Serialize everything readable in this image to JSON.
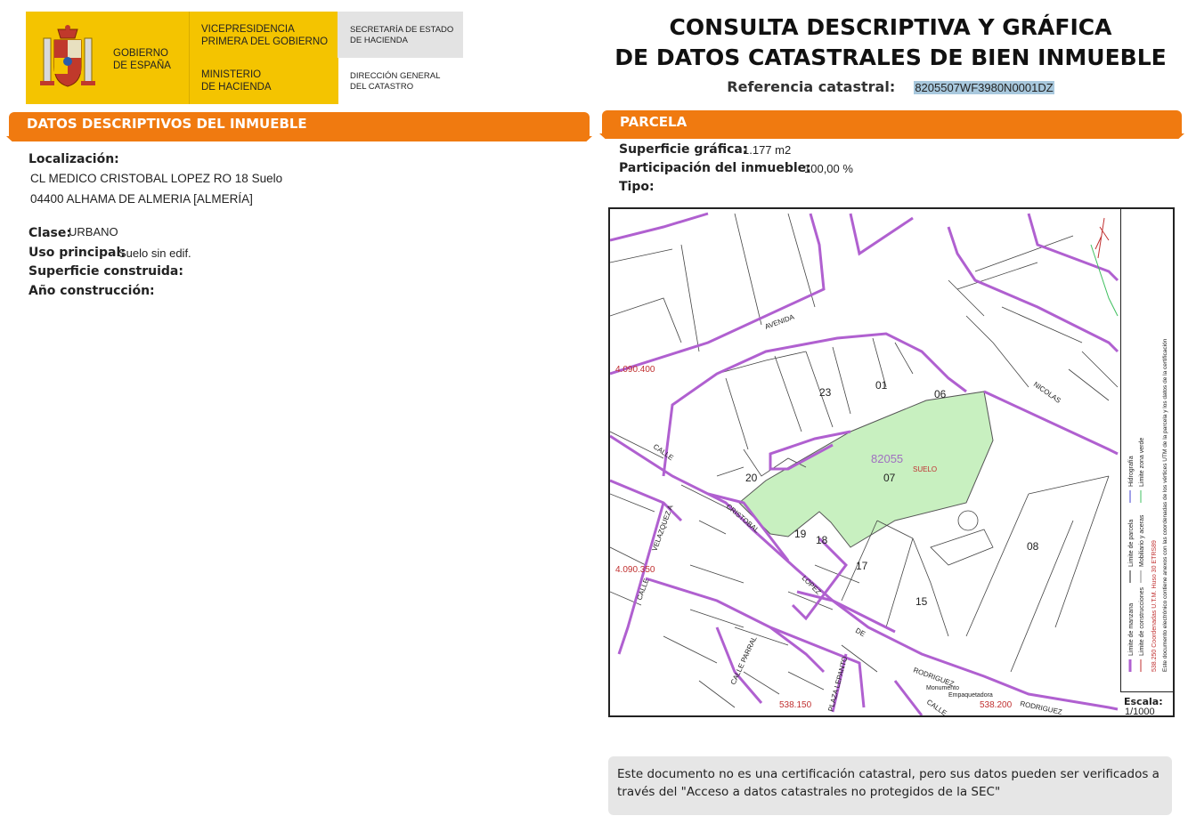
{
  "header": {
    "gov_line1": "GOBIERNO",
    "gov_line2": "DE ESPAÑA",
    "vice_line1": "VICEPRESIDENCIA",
    "vice_line2": "PRIMERA DEL GOBIERNO",
    "min_line1": "MINISTERIO",
    "min_line2": "DE HACIENDA",
    "sec_line1": "SECRETARÍA DE ESTADO",
    "sec_line2": "DE HACIENDA",
    "dir_line1": "DIRECCIÓN GENERAL",
    "dir_line2": "DEL CATASTRO",
    "title_line1": "CONSULTA DESCRIPTIVA Y GRÁFICA",
    "title_line2": "DE DATOS CATASTRALES DE BIEN INMUEBLE",
    "ref_label": "Referencia catastral:",
    "ref_value": "8205507WF3980N0001DZ"
  },
  "datos": {
    "section_title": "DATOS DESCRIPTIVOS DEL INMUEBLE",
    "localizacion_label": "Localización:",
    "address_line1": "CL MEDICO CRISTOBAL LOPEZ RO 18 Suelo",
    "address_line2": "04400 ALHAMA DE ALMERIA [ALMERÍA]",
    "clase_label": "Clase:",
    "clase_value": "URBANO",
    "uso_label": "Uso principal:",
    "uso_value": "Suelo sin edif.",
    "superficie_label": "Superficie construida:",
    "anio_label": "Año construcción:"
  },
  "parcela": {
    "section_title": "PARCELA",
    "superficie_label": "Superficie gráfica:",
    "superficie_value": "1.177 m2",
    "participacion_label": "Participación del inmueble:",
    "participacion_value": "100,00 %",
    "tipo_label": "Tipo:"
  },
  "map": {
    "parcel_color": "#c8f0c0",
    "boundary_color": "#b060d0",
    "highlight_number": "82055",
    "highlight_label": "SUELO",
    "highlight_sub": "07",
    "parcel_numbers": [
      "23",
      "01",
      "06",
      "20",
      "19",
      "18",
      "17",
      "15",
      "08"
    ],
    "street_labels": [
      "AVENIDA",
      "NICOLAS",
      "CALLE",
      "CRISTOBAL",
      "LOPEZ",
      "VELAZQUEZ A",
      "CALLE",
      "CALLE PARRAL",
      "PLAZA LEPANTO",
      "RODRIGUEZ",
      "RODRIGUEZ",
      "DE",
      "CALLE"
    ],
    "utm_labels": [
      "4.090.400",
      "4.090.350",
      "538.150",
      "538.200"
    ],
    "monument_label_1": "Monumento",
    "monument_label_2": "Empaquetadora",
    "escala_label": "Escala:",
    "escala_value": "1/1000",
    "legend": {
      "col1": [
        "Limite de manzana",
        "Limite de parcela",
        "Hidrografía"
      ],
      "col2": [
        "Limite de construcciones",
        "Mobiliario y aceras",
        "Limite zona verde"
      ],
      "col3_red": "538.250 Coordenadas U.T.M. Huso 30 ETRS89",
      "col3_text": "Este documento electrónico contiene anexos con las coordenadas de los vértices UTM de la parcela y los datos de la certificación"
    }
  },
  "note": {
    "text": "Este documento no es una certificación catastral, pero sus datos pueden ser verificados a través del \"Acceso a datos catastrales no protegidos de la SEC\""
  }
}
